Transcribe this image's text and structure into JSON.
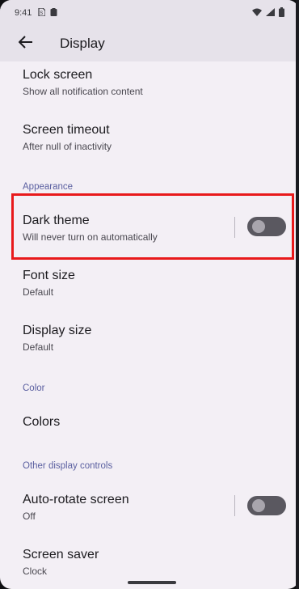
{
  "status": {
    "time": "9:41",
    "icons": [
      "sim-icon",
      "clipboard-icon",
      "wifi-icon",
      "signal-icon",
      "battery-icon"
    ]
  },
  "appbar": {
    "title": "Display",
    "back_icon": "arrow-left-icon"
  },
  "items": {
    "lock": {
      "title": "Lock screen",
      "subtitle": "Show all notification content"
    },
    "timeout": {
      "title": "Screen timeout",
      "subtitle": "After null of inactivity"
    },
    "dark": {
      "title": "Dark theme",
      "subtitle": "Will never turn on automatically",
      "on": false
    },
    "font": {
      "title": "Font size",
      "subtitle": "Default"
    },
    "display_size": {
      "title": "Display size",
      "subtitle": "Default"
    },
    "colors": {
      "title": "Colors"
    },
    "rotate": {
      "title": "Auto-rotate screen",
      "subtitle": "Off",
      "on": false
    },
    "saver": {
      "title": "Screen saver",
      "subtitle": "Clock"
    }
  },
  "sections": {
    "appearance": "Appearance",
    "color": "Color",
    "other": "Other display controls"
  },
  "colors": {
    "highlight": "#e8191b",
    "section": "#5a5fa0",
    "background": "#f3eff5"
  }
}
